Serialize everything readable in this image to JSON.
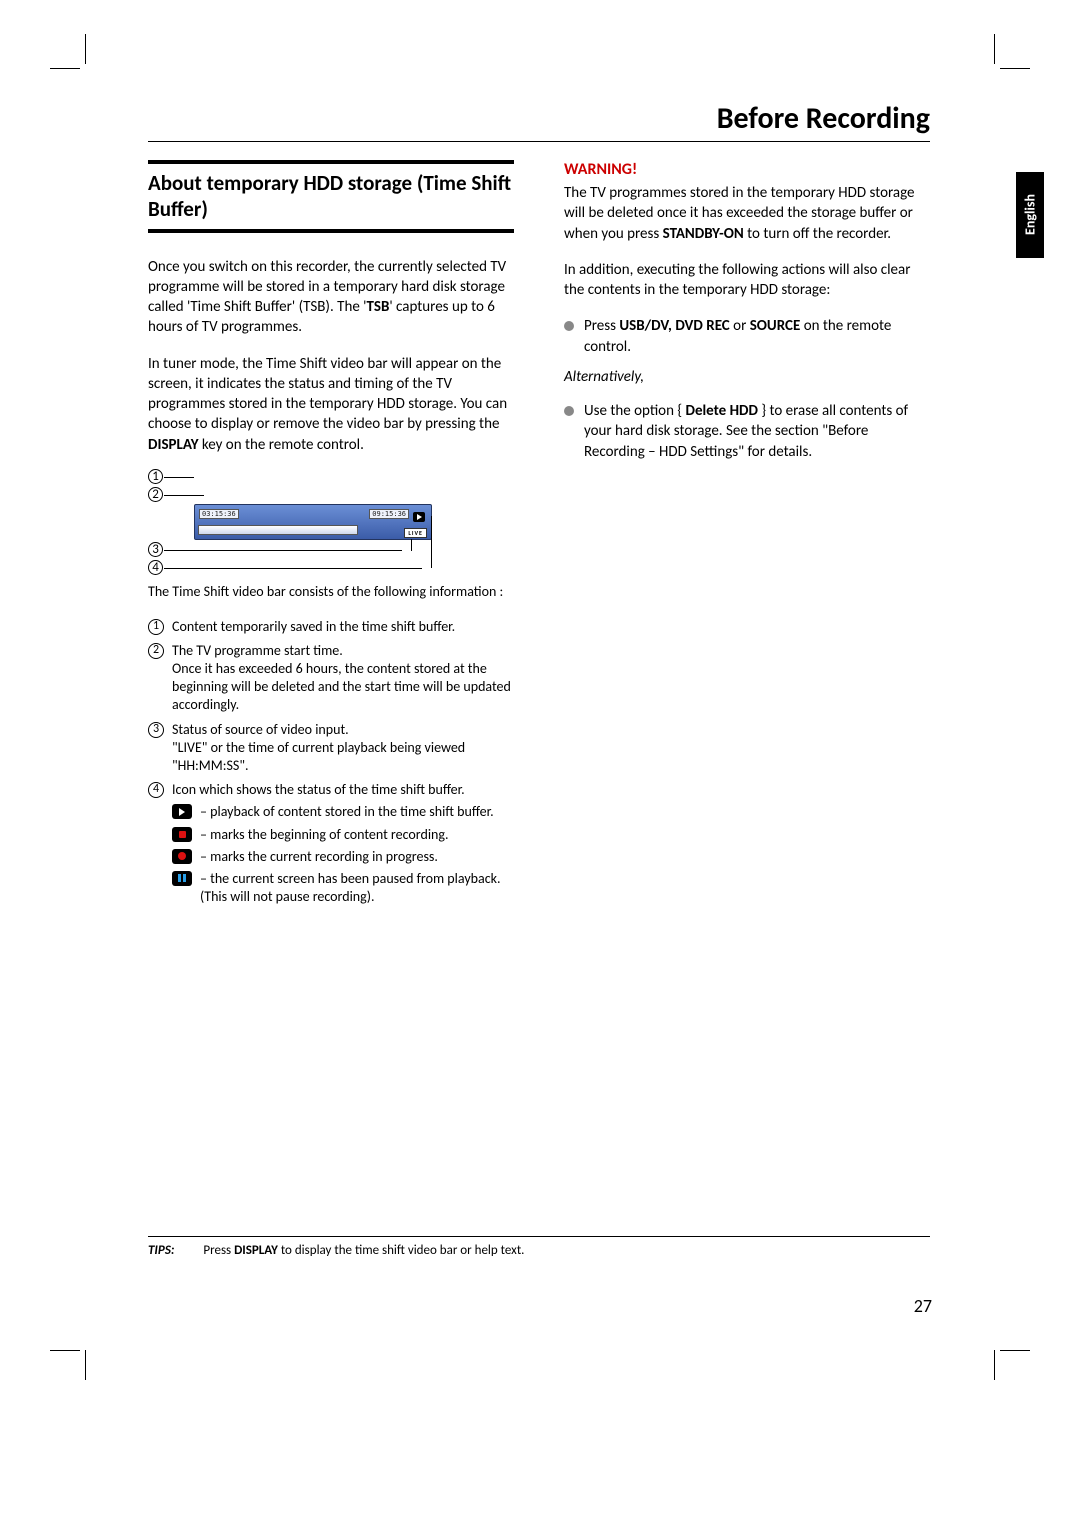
{
  "language_tab": "English",
  "page_title": "Before Recording",
  "page_number": "27",
  "section": {
    "title": "About temporary HDD storage (Time Shift Buffer)",
    "para1_a": "Once you switch on this recorder, the currently selected TV programme will be stored in a temporary hard disk storage called 'Time Shift Buffer' (TSB). The '",
    "para1_bold": "TSB",
    "para1_b": "' captures up to 6 hours of TV programmes.",
    "para2_a": "In tuner mode, the Time Shift video bar will appear on the screen, it indicates the status and timing of the TV programmes stored in the temporary HDD storage. You can choose to display or remove the video bar by pressing the ",
    "para2_bold": "DISPLAY",
    "para2_b": " key on the remote control.",
    "para3": "The Time Shift video bar consists of the following information :"
  },
  "diagram": {
    "labels": {
      "n1": "1",
      "n2": "2",
      "n3": "3",
      "n4": "4"
    },
    "time_start": "03:15:36",
    "time_now": "09:15:36",
    "live_label": "LIVE"
  },
  "info_list": {
    "i1": "Content temporarily saved in the time shift buffer.",
    "i2": "The TV programme start time.\nOnce it has exceeded 6 hours, the content stored at the beginning will be deleted and the start time will be updated accordingly.",
    "i3": "Status of source of video input.\n\"LIVE\" or the time of current playback being viewed \"HH:MM:SS\".",
    "i4": "Icon which shows the status of the time shift buffer.",
    "icon_play": "– playback of content stored in the time shift buffer.",
    "icon_rec_begin": "– marks the beginning of content recording.",
    "icon_rec_prog": "– marks the current recording in progress.",
    "icon_pause": "– the current screen has been paused from playback. (This will not pause recording)."
  },
  "warning": {
    "heading": "WARNING!",
    "p1_a": "The TV programmes stored in the temporary HDD storage will be deleted once it has exceeded the storage buffer or when you press ",
    "p1_bold": "STANDBY-ON",
    "p1_b": " to turn off the recorder.",
    "p2": "In addition, executing the following actions will also clear the contents in the temporary HDD storage:",
    "b1_a": "Press ",
    "b1_bold1": "USB/DV, DVD REC",
    "b1_mid": " or ",
    "b1_bold2": "SOURCE",
    "b1_b": " on the remote control.",
    "alt": "Alternatively,",
    "b2_a": "Use the option { ",
    "b2_bold": "Delete HDD",
    "b2_b": " } to erase all contents of your hard disk storage. See the section \"Before Recording – HDD Settings\" for details."
  },
  "tips": {
    "label": "TIPS:",
    "text_a": "Press ",
    "text_bold": "DISPLAY",
    "text_b": " to display the time shift video bar or help text."
  }
}
